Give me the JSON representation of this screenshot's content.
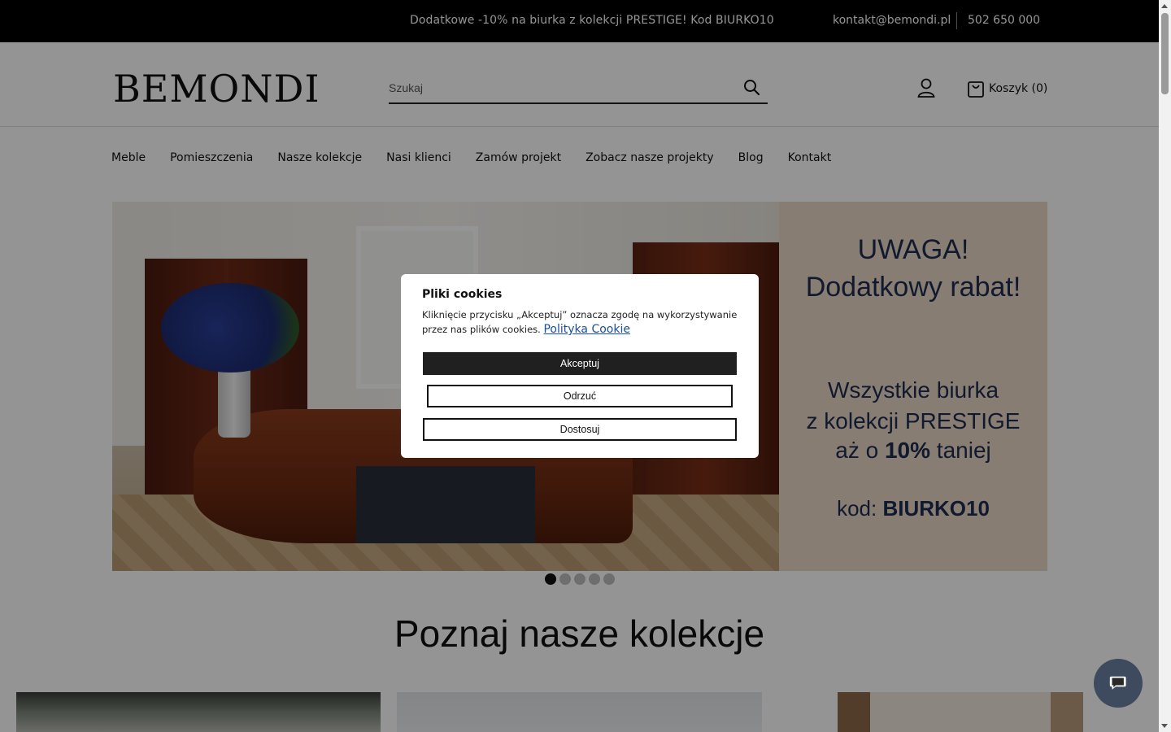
{
  "topbar": {
    "promo": "Dodatkowe -10% na biurka z kolekcji PRESTIGE! Kod BIURKO10",
    "email": "kontakt@bemondi.pl",
    "phone": "502 650 000"
  },
  "header": {
    "logo": "BEMONDI",
    "search_placeholder": "Szukaj",
    "cart_label": "Koszyk (0)"
  },
  "nav": {
    "items": [
      "Meble",
      "Pomieszczenia",
      "Nasze kolekcje",
      "Nasi klienci",
      "Zamów projekt",
      "Zobacz nasze projekty",
      "Blog",
      "Kontakt"
    ]
  },
  "hero": {
    "line1": "UWAGA!",
    "line2": "Dodatkowy rabat!",
    "line3": "Wszystkie biurka",
    "line4": "z  kolekcji  PRESTIGE",
    "line5_pre": "aż o ",
    "line5_bold": "10%",
    "line5_post": " taniej",
    "line6_pre": "kod: ",
    "line6_bold": "BIURKO10",
    "slides_total": 5,
    "active_slide": 1
  },
  "section": {
    "title": "Poznaj nasze kolekcje"
  },
  "cookie": {
    "title": "Pliki cookies",
    "text": "Kliknięcie przycisku „Akceptuj” oznacza zgodę na wykorzystywanie przez nas plików cookies.",
    "link": "Polityka Cookie",
    "accept": "Akceptuj",
    "reject": "Odrzuć",
    "customize": "Dostosuj"
  },
  "colors": {
    "topbar_bg": "#000000",
    "promo_panel_bg": "#ead8c6",
    "promo_text": "#1d2b4e",
    "chat_bg": "#3e4a5e",
    "link": "#1a4fa0"
  }
}
